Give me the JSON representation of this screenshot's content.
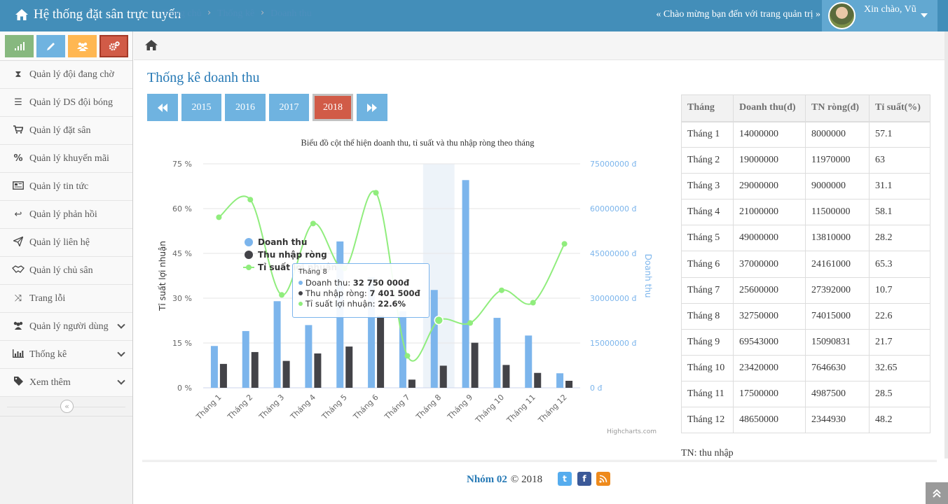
{
  "app": {
    "title": "Hệ thống đặt sân trực tuyến",
    "welcome": "« Chào mừng bạn đến với trang quản trị »",
    "greeting": "Xin chào, Vũ"
  },
  "sidebar": {
    "items": [
      {
        "label": "Quản lý đội đang chờ",
        "icon": "hourglass-icon"
      },
      {
        "label": "Quản lý DS đội bóng",
        "icon": "list-icon"
      },
      {
        "label": "Quản lý đặt sân",
        "icon": "cart-icon"
      },
      {
        "label": "Quản lý khuyến mãi",
        "icon": "percent-icon"
      },
      {
        "label": "Quản lý tin tức",
        "icon": "newspaper-icon"
      },
      {
        "label": "Quản lý phản hồi",
        "icon": "reply-icon"
      },
      {
        "label": "Quản lý liên hệ",
        "icon": "paper-plane-icon"
      },
      {
        "label": "Quản lý chủ sân",
        "icon": "handshake-icon"
      },
      {
        "label": "Trang lỗi",
        "icon": "random-icon"
      },
      {
        "label": "Quản lý người dùng",
        "icon": "users-icon"
      },
      {
        "label": "Thống kê",
        "icon": "bar-chart-icon"
      },
      {
        "label": "Xem thêm",
        "icon": "tag-icon"
      }
    ]
  },
  "breadcrumb": {
    "home": "Trang chủ",
    "level1": "Thống kê",
    "level2": "Doanh thu"
  },
  "page": {
    "title": "Thống kê doanh thu"
  },
  "years": {
    "labels": [
      "2015",
      "2016",
      "2017",
      "2018"
    ],
    "active": "2018"
  },
  "chart_data": {
    "type": "bar",
    "title": "Biểu đồ cột thể hiện doanh thu, tỉ suất và thu nhập ròng theo tháng",
    "categories": [
      "Tháng 1",
      "Tháng 2",
      "Tháng 3",
      "Tháng 4",
      "Tháng 5",
      "Tháng 6",
      "Tháng 7",
      "Tháng 8",
      "Tháng 9",
      "Tháng 10",
      "Tháng 11",
      "Tháng 12"
    ],
    "series": [
      {
        "name": "Doanh thu",
        "type": "bar",
        "axis": "right",
        "color": "#7cb5ec",
        "values": [
          14000000,
          19000000,
          29000000,
          21000000,
          49000000,
          37000000,
          25600000,
          32750000,
          69543000,
          23420000,
          17500000,
          4865000
        ]
      },
      {
        "name": "Thu nhập ròng",
        "type": "bar",
        "axis": "right",
        "color": "#434348",
        "values": [
          8000000,
          11970000,
          9000000,
          11500000,
          13810000,
          24161000,
          2739200,
          7401500,
          15090831,
          7646630,
          4987500,
          2344930
        ]
      },
      {
        "name": "Tỉ suất lợi nhuận",
        "type": "spline",
        "axis": "left",
        "color": "#90ed7d",
        "values": [
          57.1,
          63,
          31.1,
          55,
          40,
          65.3,
          10.7,
          22.6,
          21.7,
          32.65,
          28.5,
          48.2
        ]
      }
    ],
    "y_left": {
      "label": "Tỉ suất lợi nhuận",
      "ticks": [
        "0 %",
        "15 %",
        "30 %",
        "45 %",
        "60 %",
        "75 %"
      ],
      "min": 0,
      "max": 75
    },
    "y_right": {
      "label": "Doanh thu",
      "ticks": [
        "0 đ",
        "15000000 đ",
        "30000000 đ",
        "45000000 đ",
        "60000000 đ",
        "75000000 đ"
      ],
      "min": 0,
      "max": 75000000
    },
    "highlight_index": 7,
    "legend_placement": "left-inside",
    "credit": "Highcharts.com"
  },
  "tooltip": {
    "title": "Tháng 8",
    "rows": [
      {
        "label": "Doanh thu: ",
        "value": "32 750 000đ",
        "color": "#7cb5ec"
      },
      {
        "label": "Thu nhập ròng: ",
        "value": "7 401 500đ",
        "color": "#434348"
      },
      {
        "label": "Tỉ suất lợi nhuận: ",
        "value": "22.6%",
        "color": "#90ed7d"
      }
    ]
  },
  "table": {
    "headers": [
      "Tháng",
      "Doanh thu(đ)",
      "TN ròng(đ)",
      "Tỉ suất(%)"
    ],
    "rows": [
      [
        "Tháng 1",
        "14000000",
        "8000000",
        "57.1"
      ],
      [
        "Tháng 2",
        "19000000",
        "11970000",
        "63"
      ],
      [
        "Tháng 3",
        "29000000",
        "9000000",
        "31.1"
      ],
      [
        "Tháng 4",
        "21000000",
        "11500000",
        "58.1"
      ],
      [
        "Tháng 5",
        "49000000",
        "13810000",
        "28.2"
      ],
      [
        "Tháng 6",
        "37000000",
        "24161000",
        "65.3"
      ],
      [
        "Tháng 7",
        "25600000",
        "27392000",
        "10.7"
      ],
      [
        "Tháng 8",
        "32750000",
        "74015000",
        "22.6"
      ],
      [
        "Tháng 9",
        "69543000",
        "15090831",
        "21.7"
      ],
      [
        "Tháng 10",
        "23420000",
        "7646630",
        "32.65"
      ],
      [
        "Tháng 11",
        "17500000",
        "4987500",
        "28.5"
      ],
      [
        "Tháng 12",
        "48650000",
        "2344930",
        "48.2"
      ]
    ],
    "note": "TN: thu nhập"
  },
  "footer": {
    "team": "Nhóm 02",
    "copyright": "© 2018"
  },
  "colors": {
    "navbar": "#438eb9",
    "accent": "#2679b5",
    "active_year": "#d15b47"
  }
}
